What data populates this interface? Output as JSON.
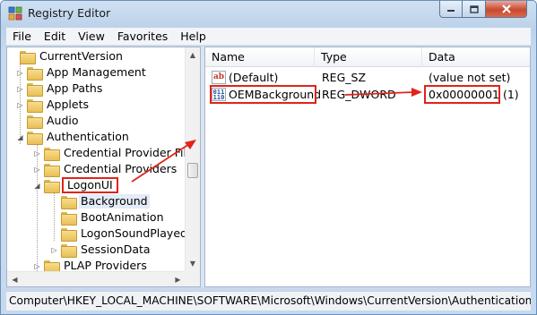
{
  "window": {
    "title": "Registry Editor",
    "icon": "registry-editor-icon",
    "controls": [
      "minimize-icon",
      "maximize-icon",
      "close-icon"
    ]
  },
  "menu": {
    "items": [
      "File",
      "Edit",
      "View",
      "Favorites",
      "Help"
    ]
  },
  "tree": {
    "items": [
      {
        "label": "CurrentVersion",
        "expander": "expanded"
      },
      {
        "label": "App Management",
        "expander": "collapsed"
      },
      {
        "label": "App Paths",
        "expander": "collapsed"
      },
      {
        "label": "Applets",
        "expander": "collapsed"
      },
      {
        "label": "Audio",
        "expander": "none"
      },
      {
        "label": "Authentication",
        "expander": "expanded"
      },
      {
        "label": "Credential Provider Filters",
        "expander": "collapsed"
      },
      {
        "label": "Credential Providers",
        "expander": "collapsed"
      },
      {
        "label": "LogonUI",
        "expander": "expanded",
        "highlighted": true
      },
      {
        "label": "Background",
        "expander": "none",
        "selected": true
      },
      {
        "label": "BootAnimation",
        "expander": "none"
      },
      {
        "label": "LogonSoundPlayed",
        "expander": "none"
      },
      {
        "label": "SessionData",
        "expander": "collapsed"
      },
      {
        "label": "PLAP Providers",
        "expander": "collapsed"
      }
    ]
  },
  "list": {
    "columns": [
      "Name",
      "Type",
      "Data"
    ],
    "rows": [
      {
        "icon": "string-value-icon",
        "icon_text": "ab",
        "name": "(Default)",
        "type": "REG_SZ",
        "data": "(value not set)"
      },
      {
        "icon": "dword-value-icon",
        "icon_text": "011\n110",
        "name": "OEMBackground",
        "type": "REG_DWORD",
        "data": "0x00000001 (1)",
        "highlighted": true
      }
    ]
  },
  "status": {
    "path": "Computer\\HKEY_LOCAL_MACHINE\\SOFTWARE\\Microsoft\\Windows\\CurrentVersion\\Authentication\\Logo"
  },
  "colors": {
    "annotation": "#e0241a",
    "selection": "#e3ecf7",
    "titlebar": "#c6d9ee"
  }
}
